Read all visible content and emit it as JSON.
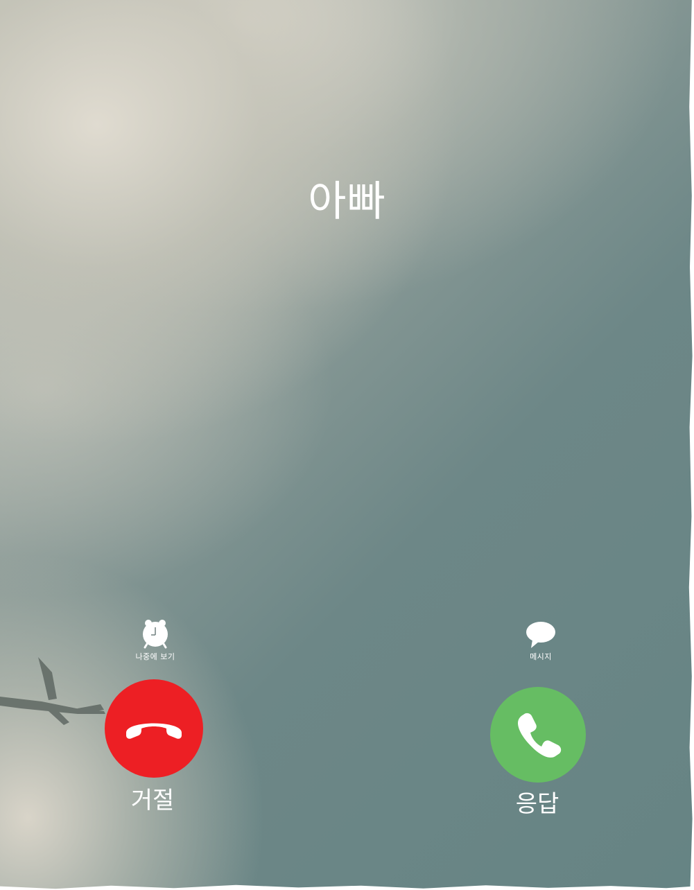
{
  "call": {
    "caller_name": "아빠"
  },
  "actions": {
    "remind_label": "나중에 보기",
    "message_label": "메시지"
  },
  "buttons": {
    "decline_label": "거절",
    "accept_label": "응답"
  },
  "icons": {
    "remind": "alarm-clock-icon",
    "message": "speech-bubble-icon",
    "decline": "phone-hangup-icon",
    "accept": "phone-icon"
  },
  "colors": {
    "decline": "#ed1f24",
    "accept": "#66bd63",
    "text": "#ffffff"
  }
}
